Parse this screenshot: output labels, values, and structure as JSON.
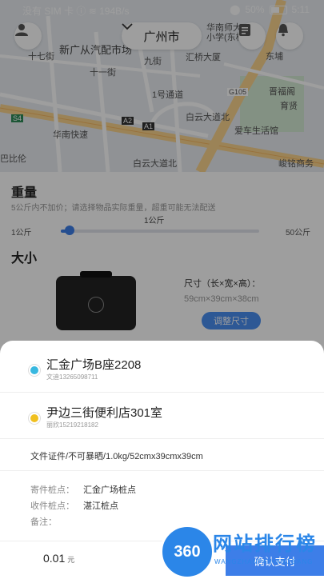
{
  "status_bar": {
    "carrier": "没有 SIM 卡",
    "speed": "194B/s",
    "battery": "50%",
    "time": "5:11"
  },
  "header": {
    "city": "广州市"
  },
  "map": {
    "labels": [
      "新广从汽配市场",
      "汇桥大厦",
      "华南师大",
      "小学(东校区)",
      "十七街",
      "十一街",
      "九街",
      "1号通道",
      "晋福阁",
      "育贤",
      "G105",
      "爱车生活馆",
      "华南快速",
      "白云大道北",
      "白云大道北",
      "A2",
      "A1",
      "S4",
      "巴比伦",
      "峻铭商务",
      "东埔"
    ]
  },
  "weight": {
    "title": "重量",
    "hint": "5公斤内不加价；请选择物品实际重量，超重可能无法配送",
    "current": "1公斤",
    "min": "1公斤",
    "max": "50公斤",
    "fraction": 0.02
  },
  "size": {
    "title": "大小",
    "label": "尺寸（长×宽×高）：",
    "value": "59cm×39cm×38cm",
    "adjust": "调整尺寸"
  },
  "sheet": {
    "sender": {
      "address": "汇金广场B座2208",
      "contact": "文迪13265098711"
    },
    "receiver": {
      "address": "尹边三街便利店301室",
      "contact": "丽欣15219218182"
    },
    "cargo": "文件证件/不可暴晒/1.0kg/52cmx39cmx39cm",
    "send_point_key": "寄件桩点：",
    "send_point_val": "汇金广场桩点",
    "recv_point_key": "收件桩点：",
    "recv_point_val": "湛江桩点",
    "note_key": "备注：",
    "price": "0.01",
    "price_unit": "元",
    "confirm": "确认支付"
  },
  "watermark": {
    "badge": "360",
    "text": "网站排行榜",
    "url": "WANGZHANPAIHANGBANG"
  },
  "colors": {
    "accent": "#3d7ee8",
    "sender_dot": "#38b8e0",
    "receiver_dot": "#f0c020"
  }
}
